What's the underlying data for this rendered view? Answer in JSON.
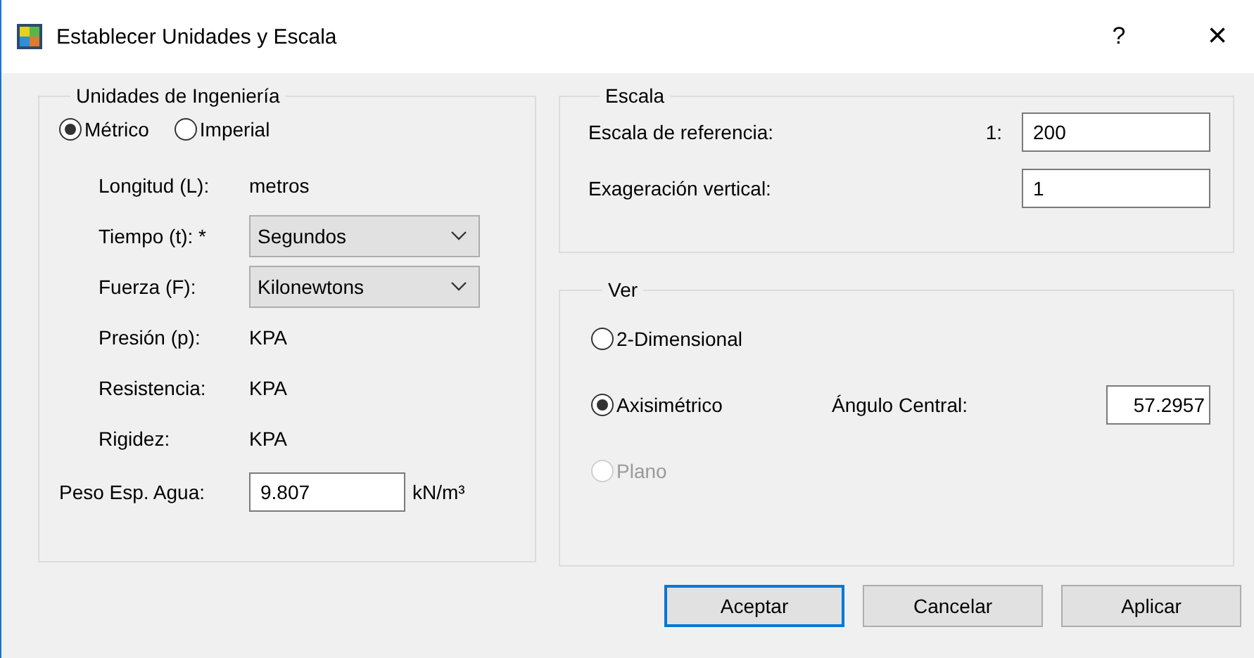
{
  "window": {
    "title": "Establecer Unidades y Escala",
    "help": "?",
    "close": "×"
  },
  "units": {
    "title": "Unidades de Ingeniería",
    "systems": [
      {
        "label": "Métrico",
        "selected": true
      },
      {
        "label": "Imperial",
        "selected": false
      }
    ],
    "rows": [
      {
        "kind": "text",
        "label": "Longitud (L):",
        "value": "metros"
      },
      {
        "kind": "dropdown",
        "label": "Tiempo (t): *",
        "value": "Segundos"
      },
      {
        "kind": "dropdown",
        "label": "Fuerza (F):",
        "value": "Kilonewtons"
      },
      {
        "kind": "text",
        "label": "Presión (p):",
        "value": "KPA"
      },
      {
        "kind": "text",
        "label": "Resistencia:",
        "value": "KPA"
      },
      {
        "kind": "text",
        "label": "Rigidez:",
        "value": "KPA"
      }
    ],
    "water": {
      "label": "Peso Esp. Agua:",
      "value": "9.807",
      "unit": "kN/m³"
    }
  },
  "scale": {
    "title": "Escala",
    "reference": {
      "label": "Escala de referencia:",
      "prefix": "1:",
      "value": "200"
    },
    "exaggeration": {
      "label": "Exageración vertical:",
      "value": "1"
    }
  },
  "view": {
    "title": "Ver",
    "options": [
      {
        "label": "2-Dimensional",
        "selected": false,
        "disabled": false
      },
      {
        "label": "Axisimétrico",
        "selected": true,
        "disabled": false,
        "field_label": "Ángulo Central:",
        "field_value": "57.2957"
      },
      {
        "label": "Plano",
        "selected": false,
        "disabled": true
      }
    ]
  },
  "buttons": [
    {
      "label": "Aceptar",
      "default": true
    },
    {
      "label": "Cancelar",
      "default": false
    },
    {
      "label": "Aplicar",
      "default": false
    }
  ]
}
